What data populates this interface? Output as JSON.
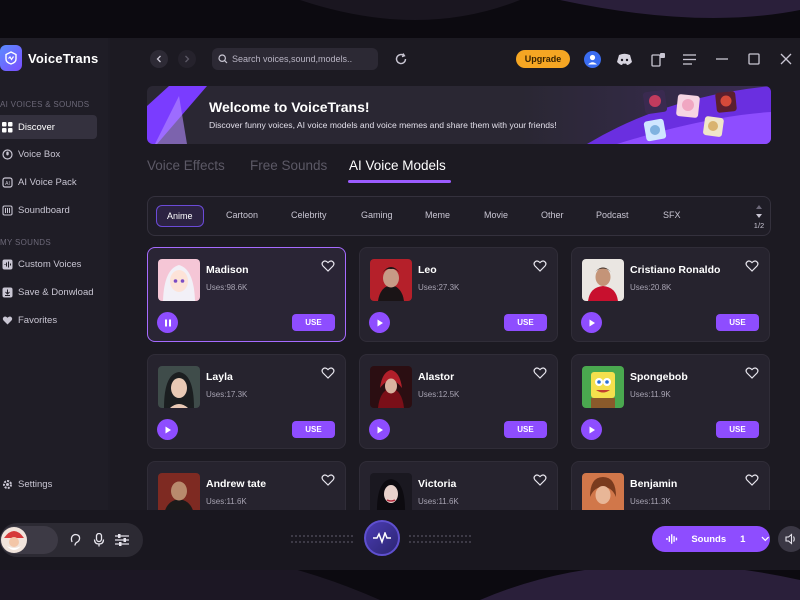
{
  "app": {
    "name": "VoiceTrans"
  },
  "sidebar": {
    "section_voices": "AI VOICES & SOUNDS",
    "section_my": "MY SOUNDS",
    "items": [
      {
        "label": "Discover",
        "icon": "grid-icon",
        "active": true
      },
      {
        "label": "Voice Box",
        "icon": "mic-icon"
      },
      {
        "label": "AI Voice Pack",
        "icon": "chip-icon"
      },
      {
        "label": "Soundboard",
        "icon": "sliders-icon"
      }
    ],
    "my_items": [
      {
        "label": "Custom Voices",
        "icon": "wave-icon"
      },
      {
        "label": "Save & Donwload",
        "icon": "download-icon"
      },
      {
        "label": "Favorites",
        "icon": "heart-icon"
      }
    ],
    "settings": "Settings"
  },
  "topbar": {
    "search_placeholder": "Search voices,sound,models..",
    "upgrade": "Upgrade"
  },
  "banner": {
    "title": "Welcome to VoiceTrans!",
    "subtitle": "Discover funny voices, AI voice models and voice memes and share them with your friends!"
  },
  "tabs": [
    "Voice Effects",
    "Free Sounds",
    "AI Voice Models"
  ],
  "categories": [
    "Anime",
    "Cartoon",
    "Celebrity",
    "Gaming",
    "Meme",
    "Movie",
    "Other",
    "Podcast",
    "SFX"
  ],
  "pager": "1/2",
  "use_label": "USE",
  "cards": [
    {
      "name": "Madison",
      "uses": "Uses:98.6K"
    },
    {
      "name": "Leo",
      "uses": "Uses:27.3K"
    },
    {
      "name": "Cristiano Ronaldo",
      "uses": "Uses:20.8K"
    },
    {
      "name": "Layla",
      "uses": "Uses:17.3K"
    },
    {
      "name": "Alastor",
      "uses": "Uses:12.5K"
    },
    {
      "name": "Spongebob",
      "uses": "Uses:11.9K"
    },
    {
      "name": "Andrew tate",
      "uses": "Uses:11.6K"
    },
    {
      "name": "Victoria",
      "uses": "Uses:11.6K"
    },
    {
      "name": "Benjamin",
      "uses": "Uses:11.3K"
    }
  ],
  "bottom": {
    "sounds_label": "Sounds",
    "sounds_count": "1"
  },
  "colors": {
    "accent": "#8e4dff",
    "upgrade": "#f5a623"
  }
}
